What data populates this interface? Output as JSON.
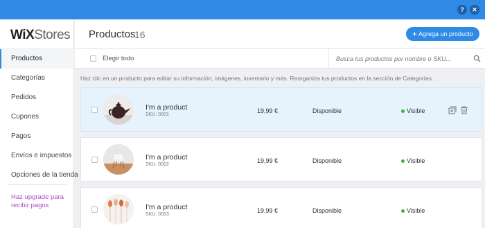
{
  "window": {
    "help_label": "?",
    "close_label": "✕"
  },
  "brand": {
    "wix": "WiX",
    "stores": "Stores"
  },
  "sidebar": {
    "items": [
      {
        "label": "Productos",
        "active": true
      },
      {
        "label": "Categorías",
        "active": false
      },
      {
        "label": "Pedidos",
        "active": false
      },
      {
        "label": "Cupones",
        "active": false
      },
      {
        "label": "Pagos",
        "active": false
      },
      {
        "label": "Envíos e impuestos",
        "active": false
      },
      {
        "label": "Opciones de la tienda",
        "active": false
      }
    ],
    "upgrade_label": "Haz upgrade para recibir pagos"
  },
  "header": {
    "title": "Productos",
    "count": "16",
    "add_button": "Agrega un producto"
  },
  "toolbar": {
    "select_all": "Elegir todo",
    "search_placeholder": "Busca tus productos por nombre o SKU..."
  },
  "hint": "Haz clic en un producto para editar su información, imágenes, inventario y más. Reorganiza tus productos en la sección de Categorías.",
  "products": [
    {
      "name": "I'm a product",
      "sku": "SKU: 0001",
      "price": "19,99 €",
      "stock": "Disponible",
      "visibility": "Visible",
      "image": "teapot",
      "selected": true
    },
    {
      "name": "I'm a product",
      "sku": "SKU: 0002",
      "price": "19,99 €",
      "stock": "Disponible",
      "visibility": "Visible",
      "image": "chair",
      "selected": false
    },
    {
      "name": "I'm a product",
      "sku": "SKU: 0003",
      "price": "19,99 €",
      "stock": "Disponible",
      "visibility": "Visible",
      "image": "spoons",
      "selected": false
    }
  ],
  "colors": {
    "accent": "#2f8ae5",
    "upgrade": "#aa4dc8",
    "visible_dot": "#38b24a",
    "selected_row": "#e6f2fc"
  }
}
